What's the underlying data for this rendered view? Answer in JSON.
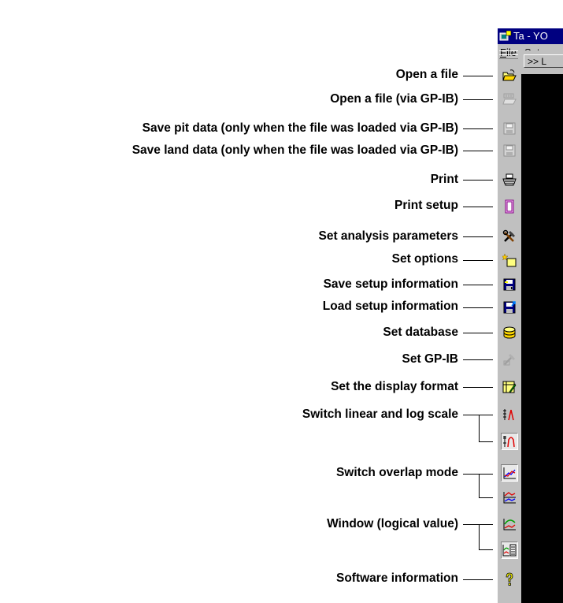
{
  "window": {
    "title": "Ta - YO",
    "menu": [
      {
        "label": "File",
        "mnemonic": "F",
        "rest": "ile"
      },
      {
        "label": "Set",
        "mnemonic": "S",
        "rest": "et"
      }
    ],
    "tab_label": ">> L",
    "colors": {
      "titlebar": "#000080",
      "face": "#c0c0c0",
      "client": "#000000"
    }
  },
  "toolbar": {
    "items": [
      {
        "id": "open-file",
        "label": "Open a file",
        "icon": "open-folder-icon"
      },
      {
        "id": "open-gpib",
        "label": "Open a file (via GP-IB)",
        "icon": "open-gpib-icon"
      },
      {
        "id": "save-pit",
        "label": "Save pit data (only when the file was loaded via GP-IB)",
        "icon": "save-pit-icon"
      },
      {
        "id": "save-land",
        "label": "Save land data (only when the file was loaded via GP-IB)",
        "icon": "save-land-icon"
      },
      {
        "id": "print",
        "label": "Print",
        "icon": "printer-icon"
      },
      {
        "id": "print-setup",
        "label": "Print setup",
        "icon": "print-setup-icon"
      },
      {
        "id": "analysis-params",
        "label": "Set analysis parameters",
        "icon": "tools-icon"
      },
      {
        "id": "options",
        "label": "Set options",
        "icon": "options-icon"
      },
      {
        "id": "save-setup",
        "label": "Save setup information",
        "icon": "floppy-save-icon"
      },
      {
        "id": "load-setup",
        "label": "Load setup information",
        "icon": "floppy-load-icon"
      },
      {
        "id": "database",
        "label": "Set database",
        "icon": "database-icon"
      },
      {
        "id": "gpib",
        "label": "Set GP-IB",
        "icon": "gpib-icon"
      },
      {
        "id": "display-format",
        "label": "Set the display format",
        "icon": "display-format-icon"
      },
      {
        "id": "scale",
        "label": "Switch linear and log scale",
        "icon": "linear-scale-icon",
        "icon2": "log-scale-icon"
      },
      {
        "id": "overlap",
        "label": "Switch overlap mode",
        "icon": "overlap-on-icon",
        "icon2": "overlap-off-icon"
      },
      {
        "id": "window-logical",
        "label": "Window (logical value)",
        "icon": "graph-window-icon",
        "icon2": "table-window-icon"
      },
      {
        "id": "about",
        "label": "Software information",
        "icon": "help-icon"
      }
    ]
  }
}
